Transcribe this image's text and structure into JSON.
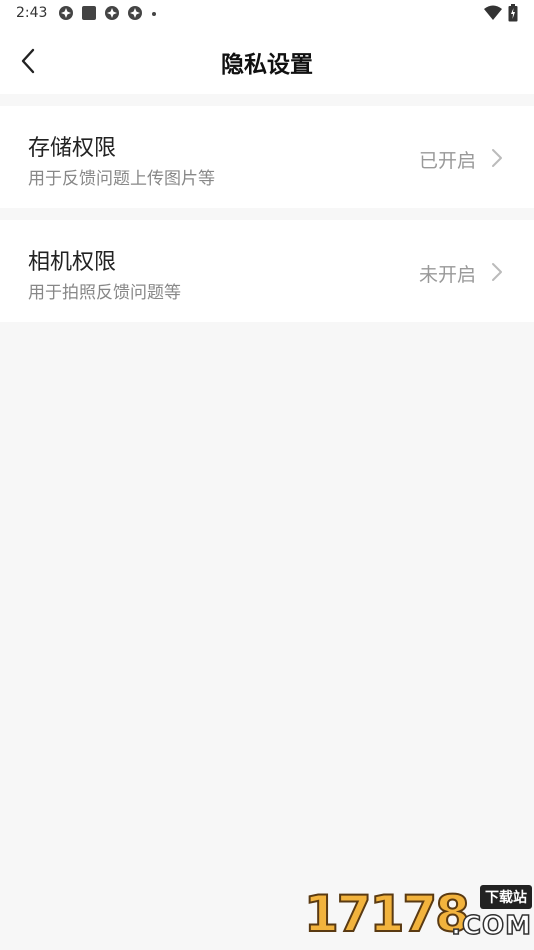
{
  "status_bar": {
    "time": "2:43",
    "left_icons": [
      "app-notification-icon",
      "square-notification-icon",
      "app-notification-icon",
      "app-notification-icon",
      "dot-icon"
    ],
    "right_icons": [
      "wifi-icon",
      "battery-icon"
    ]
  },
  "header": {
    "title": "隐私设置",
    "back_icon": "chevron-left-icon"
  },
  "permissions": [
    {
      "title": "存储权限",
      "subtitle": "用于反馈问题上传图片等",
      "status": "已开启"
    },
    {
      "title": "相机权限",
      "subtitle": "用于拍照反馈问题等",
      "status": "未开启"
    }
  ],
  "watermark": {
    "digits": "17178",
    "tag": "下载站",
    "domain": ".COM"
  },
  "colors": {
    "page_bg": "#f7f7f7",
    "card_bg": "#ffffff",
    "title_text": "#111111",
    "subtitle_text": "#888888",
    "status_text": "#999999",
    "watermark_orange": "#f2b33d"
  }
}
